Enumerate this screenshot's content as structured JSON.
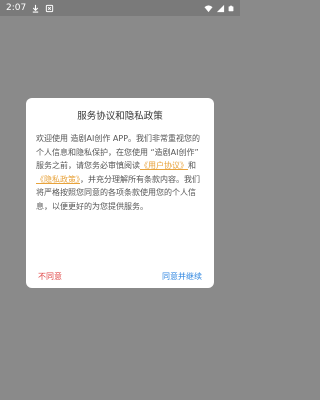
{
  "status_bar": {
    "time": "2:07",
    "icons": [
      "download-icon",
      "notification-icon",
      "wifi-icon",
      "signal-icon",
      "battery-icon"
    ]
  },
  "dialog": {
    "title": "服务协议和隐私政策",
    "body_part1": "欢迎使用 造剧AI创作 APP。我们非常重视您的个人信息和隐私保护，在您使用 “造剧AI创作” 服务之前，请您务必审慎阅读",
    "user_agreement_link": "《用户协议》",
    "and_text": "和",
    "privacy_policy_link": "《隐私政策》",
    "body_part2": "，并充分理解所有条款内容。我们将严格按照您同意的各项条款使用您的个人信息，以便更好的为您提供服务。",
    "disagree_label": "不同意",
    "agree_label": "同意并继续"
  },
  "colors": {
    "link": "#e8a33c",
    "disagree": "#e04646",
    "agree": "#2f86e0",
    "overlay": "#8a8a8a"
  }
}
